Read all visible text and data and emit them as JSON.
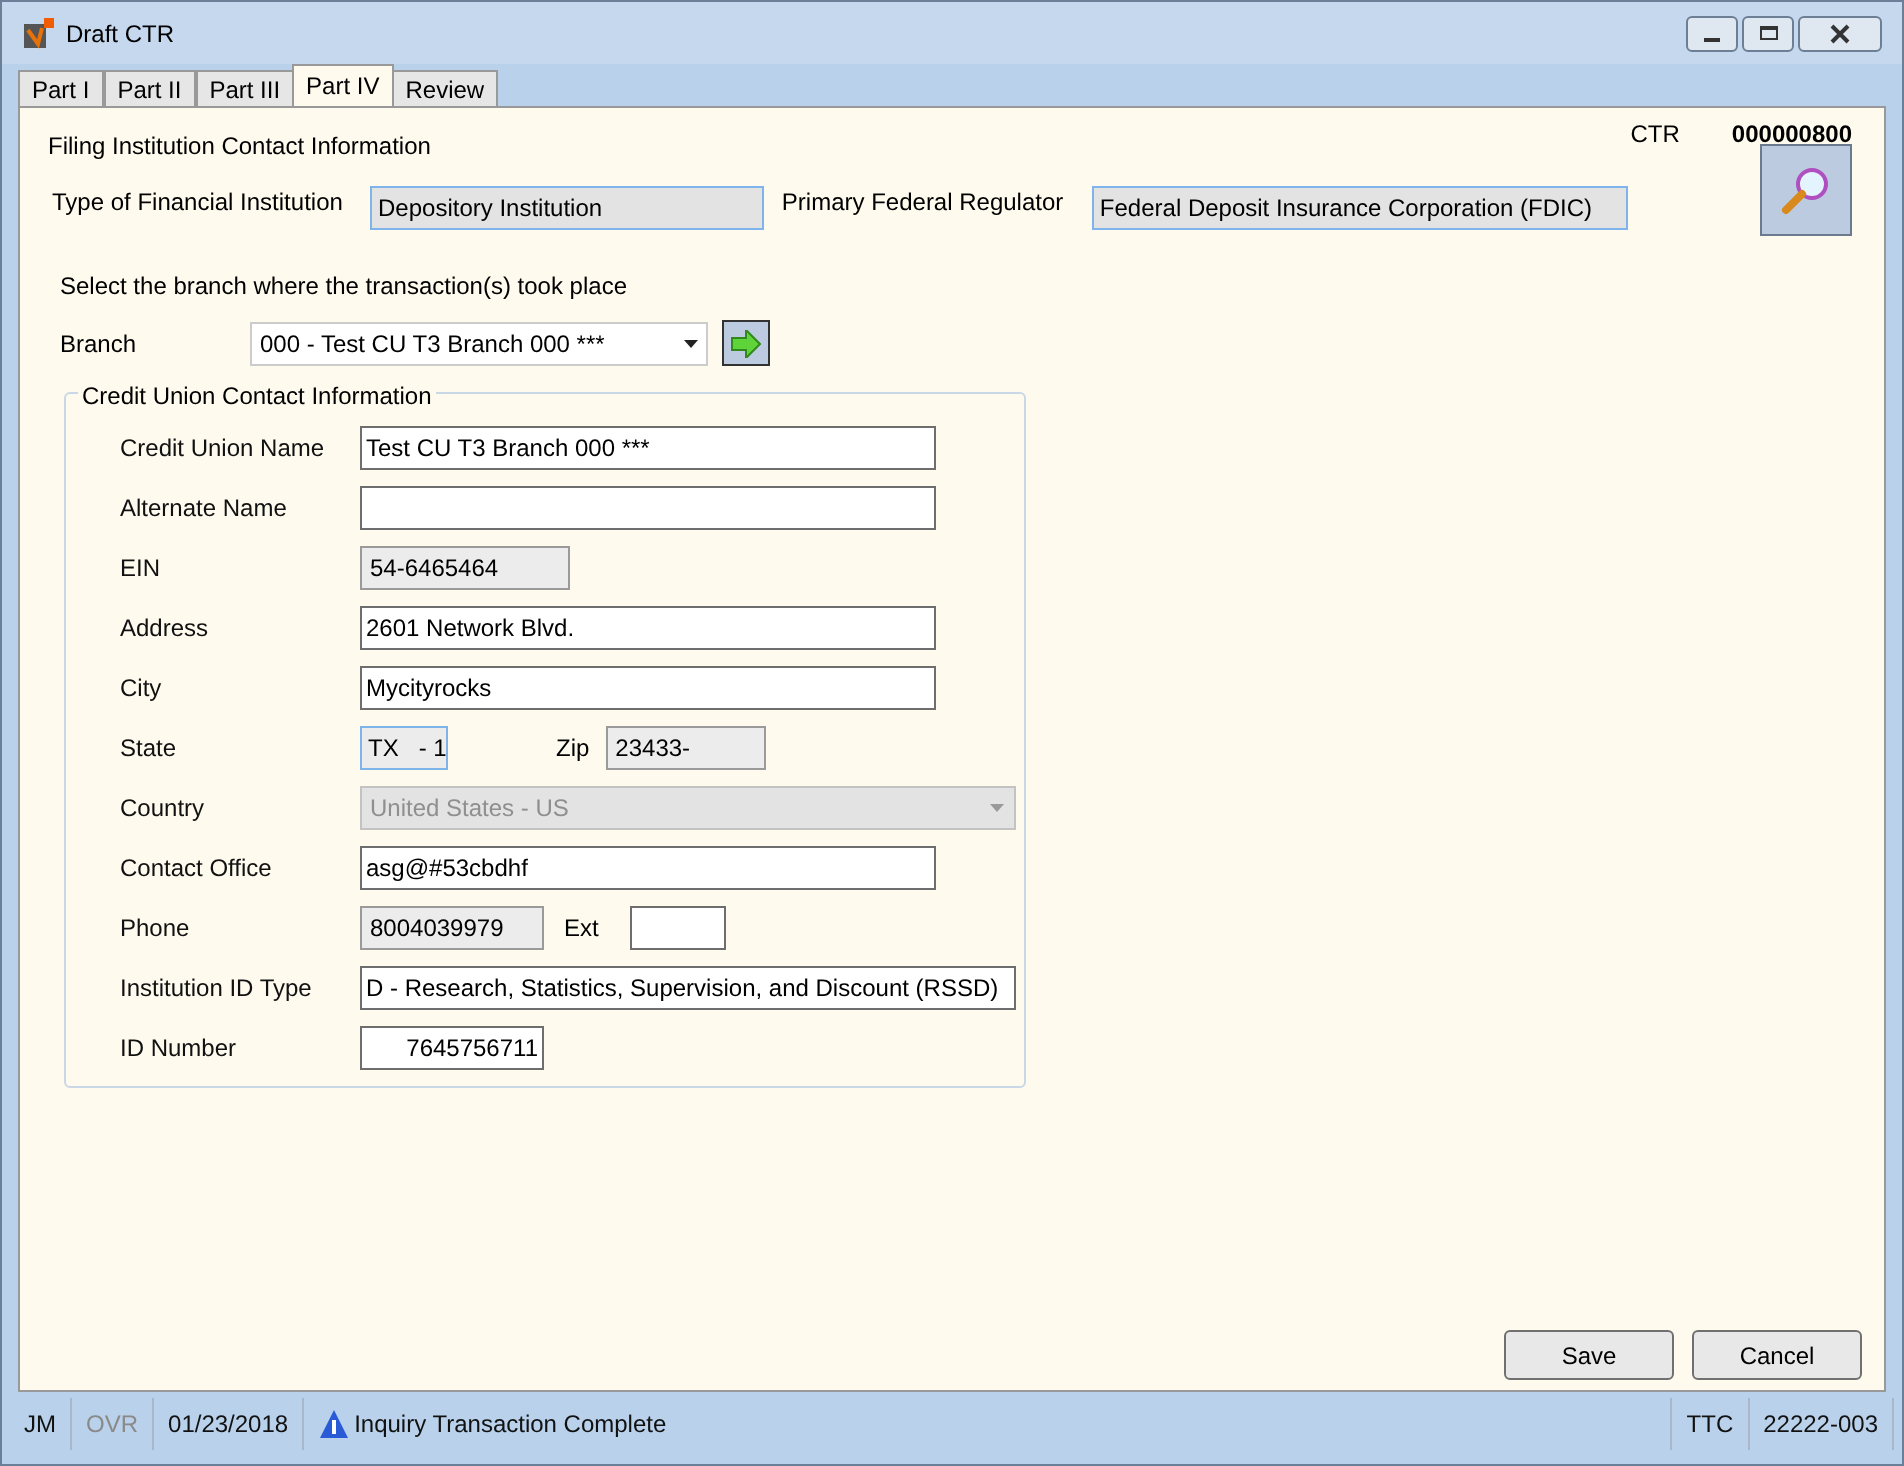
{
  "window": {
    "title": "Draft CTR"
  },
  "tabs": [
    {
      "label": "Part I",
      "selected": false
    },
    {
      "label": "Part II",
      "selected": false
    },
    {
      "label": "Part III",
      "selected": false
    },
    {
      "label": "Part IV",
      "selected": true
    },
    {
      "label": "Review",
      "selected": false
    }
  ],
  "section_title": "Filing Institution Contact Information",
  "ctr": {
    "label": "CTR",
    "value": "000000800"
  },
  "institution": {
    "type_label": "Type of Financial Institution",
    "type_value": "Depository Institution",
    "regulator_label": "Primary Federal Regulator",
    "regulator_value": "Federal Deposit Insurance Corporation (FDIC)"
  },
  "branch_prompt": "Select the branch where the transaction(s) took place",
  "branch": {
    "label": "Branch",
    "value": "000 - Test CU T3 Branch 000 ***"
  },
  "group": {
    "title": "Credit Union Contact Information",
    "fields": [
      {
        "label": "Credit Union Name",
        "kind": "text",
        "value": "Test CU T3 Branch 000 ***"
      },
      {
        "label": "Alternate Name",
        "kind": "text"
      },
      {
        "label": "EIN",
        "kind": "readonly",
        "value": "54-6465464"
      },
      {
        "label": "Address",
        "kind": "text",
        "value": "2601 Network Blvd."
      },
      {
        "label": "City",
        "kind": "text",
        "value": "Mycityrocks"
      },
      {
        "label": "State",
        "kind": "pair",
        "value": "TX   - 1",
        "second_label": "Zip",
        "second_value": "23433-"
      },
      {
        "label": "Country",
        "kind": "select",
        "disabled": true,
        "value": "United States - US"
      },
      {
        "label": "Contact Office",
        "kind": "text",
        "value": "asg@#53cbdhf"
      },
      {
        "label": "Phone",
        "kind": "phone",
        "value": "8004039979",
        "second_label": "Ext"
      },
      {
        "label": "Institution ID Type",
        "kind": "text",
        "value": "D - Research, Statistics, Supervision, and Discount (RSSD)"
      },
      {
        "label": "ID Number",
        "kind": "number",
        "value": "7645756711"
      }
    ]
  },
  "buttons": [
    "Save",
    "Cancel"
  ],
  "status_bar": [
    {
      "text": "JM",
      "disabled": false
    },
    {
      "text": "OVR",
      "disabled": true
    },
    {
      "text": "01/23/2018",
      "disabled": false
    },
    {
      "text": "Inquiry Transaction Complete",
      "kind": "message",
      "disabled": false
    },
    {
      "text": "TTC",
      "kind": "right",
      "disabled": false
    },
    {
      "text": "22222-003",
      "disabled": false
    }
  ]
}
